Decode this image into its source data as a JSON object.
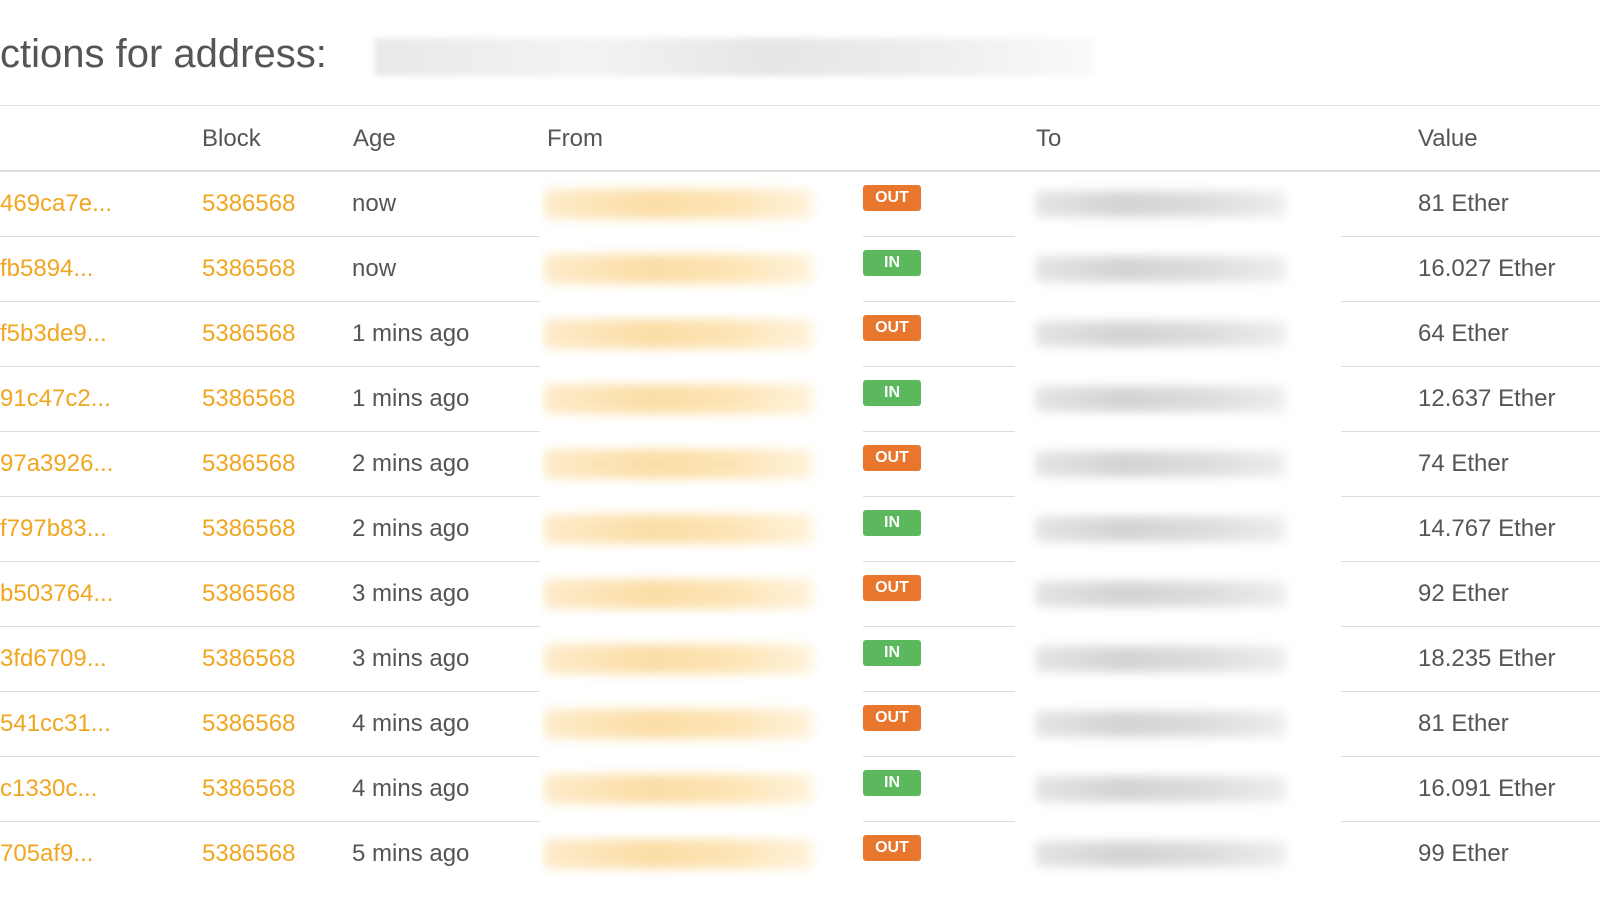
{
  "header": {
    "title": "ctions for address:"
  },
  "table": {
    "columns": {
      "txhash": "",
      "block": "Block",
      "age": "Age",
      "from": "From",
      "direction": "",
      "to": "To",
      "value": "Value"
    },
    "rows": [
      {
        "hash": "469ca7e...",
        "block": "5386568",
        "age": "now",
        "direction": "OUT",
        "value": "81 Ether"
      },
      {
        "hash": "fb5894...",
        "block": "5386568",
        "age": "now",
        "direction": "IN",
        "value": "16.027 Ether"
      },
      {
        "hash": "f5b3de9...",
        "block": "5386568",
        "age": "1 mins ago",
        "direction": "OUT",
        "value": "64 Ether"
      },
      {
        "hash": "91c47c2...",
        "block": "5386568",
        "age": "1 mins ago",
        "direction": "IN",
        "value": "12.637 Ether"
      },
      {
        "hash": "97a3926...",
        "block": "5386568",
        "age": "2 mins ago",
        "direction": "OUT",
        "value": "74 Ether"
      },
      {
        "hash": "f797b83...",
        "block": "5386568",
        "age": "2 mins ago",
        "direction": "IN",
        "value": "14.767 Ether"
      },
      {
        "hash": "b503764...",
        "block": "5386568",
        "age": "3 mins ago",
        "direction": "OUT",
        "value": "92 Ether"
      },
      {
        "hash": "3fd6709...",
        "block": "5386568",
        "age": "3 mins ago",
        "direction": "IN",
        "value": "18.235 Ether"
      },
      {
        "hash": "541cc31...",
        "block": "5386568",
        "age": "4 mins ago",
        "direction": "OUT",
        "value": "81 Ether"
      },
      {
        "hash": "c1330c...",
        "block": "5386568",
        "age": "4 mins ago",
        "direction": "IN",
        "value": "16.091 Ether"
      },
      {
        "hash": "705af9...",
        "block": "5386568",
        "age": "5 mins ago",
        "direction": "OUT",
        "value": "99 Ether"
      }
    ]
  },
  "colors": {
    "link": "#f0a621",
    "out_badge": "#e8762d",
    "in_badge": "#5cb85c",
    "text": "#555555"
  }
}
